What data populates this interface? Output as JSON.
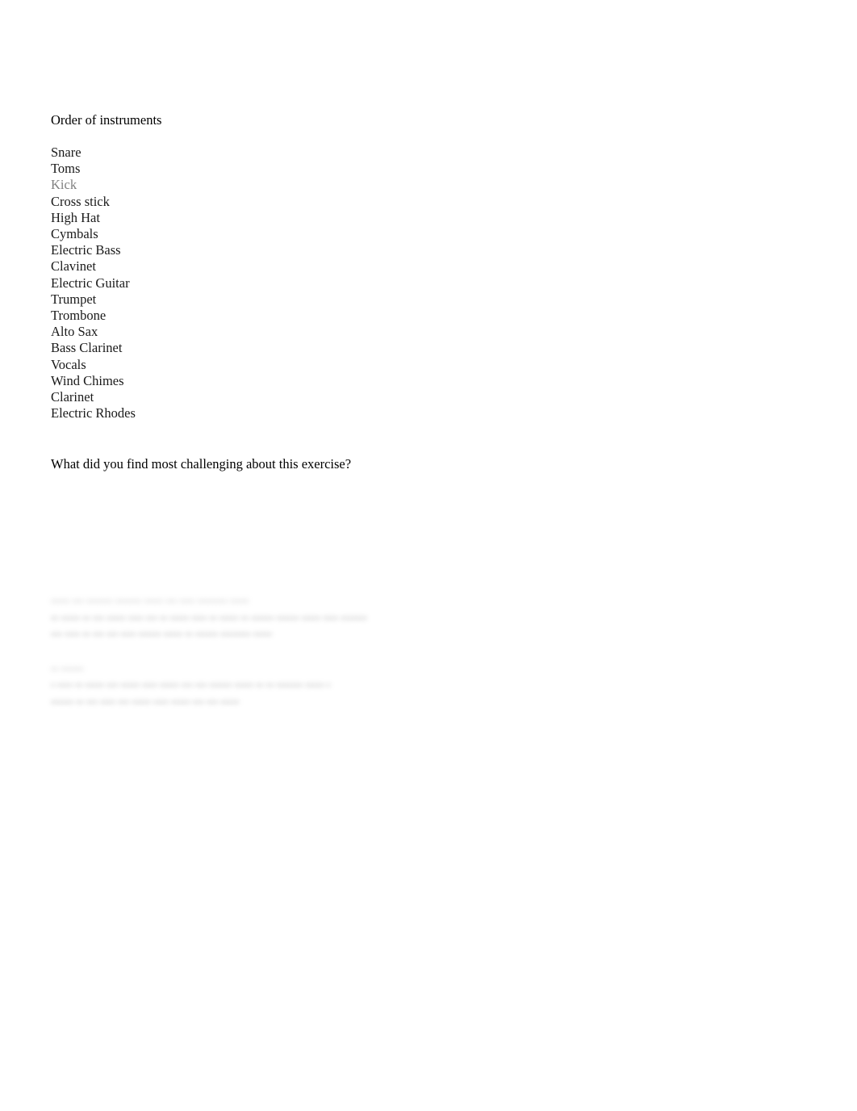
{
  "document": {
    "background_color": "#ffffff",
    "text_color": "#000000",
    "muted_text_color": "#808080",
    "heading": "Order of instruments",
    "instruments": [
      {
        "label": "Snare",
        "muted": false
      },
      {
        "label": "Toms",
        "muted": false
      },
      {
        "label": "Kick",
        "muted": true
      },
      {
        "label": "Cross stick",
        "muted": false
      },
      {
        "label": "High Hat",
        "muted": false
      },
      {
        "label": "Cymbals",
        "muted": false
      },
      {
        "label": "Electric Bass",
        "muted": false
      },
      {
        "label": "Clavinet",
        "muted": false
      },
      {
        "label": "Electric Guitar",
        "muted": false
      },
      {
        "label": "Trumpet",
        "muted": false
      },
      {
        "label": "Trombone",
        "muted": false
      },
      {
        "label": "Alto Sax",
        "muted": false
      },
      {
        "label": "Bass Clarinet",
        "muted": false
      },
      {
        "label": "Vocals",
        "muted": false
      },
      {
        "label": "Wind Chimes",
        "muted": false
      },
      {
        "label": "Clarinet",
        "muted": false
      },
      {
        "label": "Electric Rhodes",
        "muted": false
      }
    ],
    "question": "What did you find most challenging about this exercise?",
    "redacted": {
      "note": "illegible-blurred-text",
      "blocks": [
        {
          "lines": [
            {
              "text": "••••• ••• ••••••• ••••••• ••••• ••• •••• •••••••• •••••",
              "width": "w-lead",
              "lead": true
            },
            {
              "text": "•• ••••• •• ••• ••••• •••• ••• •• ••••• •••• •• ••••• •• •••••• •••••• ••••• •••• •••••••",
              "width": "w-wide",
              "lead": false
            },
            {
              "text": "••• •••• •• ••• ••• •••• •••••• ••••• •• •••••• •••••••• •••••",
              "width": "w-mid",
              "lead": false
            }
          ]
        },
        {
          "lines": [
            {
              "text": "•• ••••••",
              "width": "w-tag",
              "lead": true
            },
            {
              "text": "• •••• •• ••••• ••• ••••• •••• ••••• ••• ••• •••••• ••••• •• •• ••••••• ••••• •",
              "width": "w-long",
              "lead": false
            },
            {
              "text": "•••••• •• ••• •••• ••• ••••• •••• ••••• ••• ••• •••••",
              "width": "w-end",
              "lead": false
            }
          ]
        }
      ]
    }
  }
}
